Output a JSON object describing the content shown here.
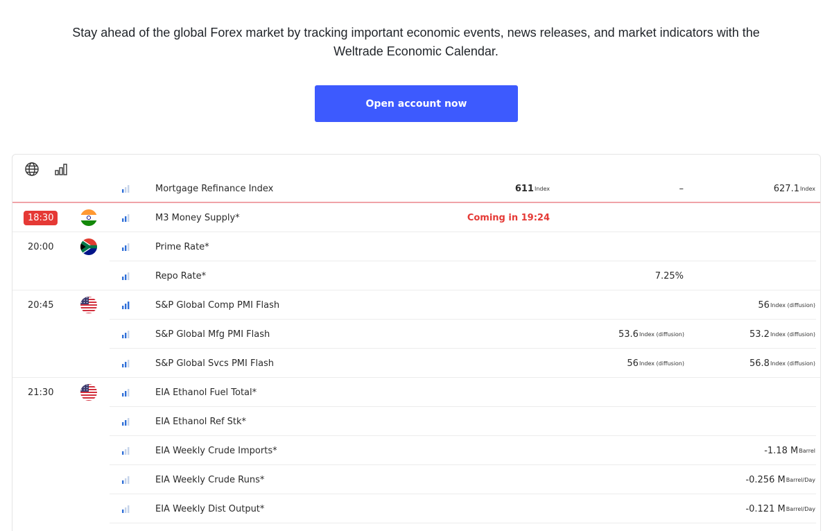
{
  "intro": {
    "line1": "Stay ahead of the global Forex market by tracking important economic events, news releases, and market indicators with the",
    "line2": "Weltrade Economic Calendar."
  },
  "cta": {
    "label": "Open account now",
    "color": "#3d5afe"
  },
  "toolbar": {
    "globe_icon": "globe-icon",
    "importance_icon": "bar-chart-icon"
  },
  "colors": {
    "accent_red": "#e53935",
    "importance_active": "#2f6fd8",
    "importance_inactive": "#c5d3ea"
  },
  "events": [
    {
      "time": "",
      "country": "",
      "importance": 1,
      "name": "Mortgage Refinance Index",
      "actual": "611",
      "actual_unit": "Index",
      "forecast": "–",
      "forecast_unit": "",
      "previous": "627.1",
      "previous_unit": "Index"
    },
    {
      "time": "18:30",
      "current": true,
      "country": "India",
      "importance": 2,
      "name": "M3 Money Supply*",
      "countdown": "Coming in 19:24",
      "actual": "",
      "actual_unit": "",
      "forecast": "",
      "forecast_unit": "",
      "previous": "",
      "previous_unit": ""
    },
    {
      "time": "20:00",
      "country": "South Africa",
      "importance": 2,
      "name": "Prime Rate*",
      "actual": "",
      "actual_unit": "",
      "forecast": "",
      "forecast_unit": "",
      "previous": "",
      "previous_unit": ""
    },
    {
      "time": "",
      "country": "",
      "importance": 2,
      "name": "Repo Rate*",
      "actual": "",
      "actual_unit": "",
      "forecast": "7.25%",
      "forecast_unit": "",
      "previous": "",
      "previous_unit": ""
    },
    {
      "time": "20:45",
      "country": "United States",
      "importance": 3,
      "name": "S&P Global Comp PMI Flash",
      "actual": "",
      "actual_unit": "",
      "forecast": "",
      "forecast_unit": "",
      "previous": "56",
      "previous_unit": "Index (diffusion)"
    },
    {
      "time": "",
      "country": "",
      "importance": 2,
      "name": "S&P Global Mfg PMI Flash",
      "actual": "",
      "actual_unit": "",
      "forecast": "53.6",
      "forecast_unit": "Index (diffusion)",
      "previous": "53.2",
      "previous_unit": "Index (diffusion)"
    },
    {
      "time": "",
      "country": "",
      "importance": 2,
      "name": "S&P Global Svcs PMI Flash",
      "actual": "",
      "actual_unit": "",
      "forecast": "56",
      "forecast_unit": "Index (diffusion)",
      "previous": "56.8",
      "previous_unit": "Index (diffusion)"
    },
    {
      "time": "21:30",
      "country": "United States",
      "importance": 2,
      "name": "EIA Ethanol Fuel Total*",
      "actual": "",
      "actual_unit": "",
      "forecast": "",
      "forecast_unit": "",
      "previous": "",
      "previous_unit": ""
    },
    {
      "time": "",
      "country": "",
      "importance": 2,
      "name": "EIA Ethanol Ref Stk*",
      "actual": "",
      "actual_unit": "",
      "forecast": "",
      "forecast_unit": "",
      "previous": "",
      "previous_unit": ""
    },
    {
      "time": "",
      "country": "",
      "importance": 1,
      "name": "EIA Weekly Crude Imports*",
      "actual": "",
      "actual_unit": "",
      "forecast": "",
      "forecast_unit": "",
      "previous": "-1.18 M",
      "previous_unit": "Barrel"
    },
    {
      "time": "",
      "country": "",
      "importance": 1,
      "name": "EIA Weekly Crude Runs*",
      "actual": "",
      "actual_unit": "",
      "forecast": "",
      "forecast_unit": "",
      "previous": "-0.256 M",
      "previous_unit": "Barrel/Day"
    },
    {
      "time": "",
      "country": "",
      "importance": 1,
      "name": "EIA Weekly Dist Output*",
      "actual": "",
      "actual_unit": "",
      "forecast": "",
      "forecast_unit": "",
      "previous": "-0.121 M",
      "previous_unit": "Barrel/Day"
    }
  ]
}
